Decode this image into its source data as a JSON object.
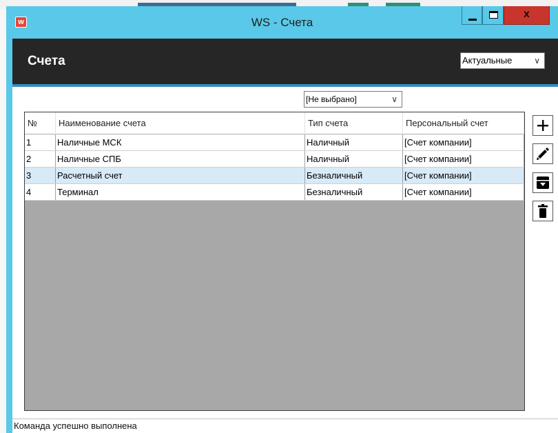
{
  "window": {
    "title": "WS - Счета"
  },
  "header": {
    "title": "Счета"
  },
  "filters": {
    "status_value": "Актуальные",
    "type_value": "[Не выбрано]"
  },
  "table": {
    "columns": [
      "№",
      "Наименование счета",
      "Тип счета",
      "Персональный счет"
    ],
    "rows": [
      [
        "1",
        "Наличные МСК",
        "Наличный",
        "[Счет компании]"
      ],
      [
        "2",
        "Наличные СПБ",
        "Наличный",
        "[Счет компании]"
      ],
      [
        "3",
        "Расчетный счет",
        "Безналичный",
        "[Счет компании]"
      ],
      [
        "4",
        "Терминал",
        "Безналичный",
        "[Счет компании]"
      ]
    ],
    "selected_row": 3
  },
  "toolbar": {
    "icons": [
      "plus-icon",
      "pencil-icon",
      "archive-icon",
      "trash-icon"
    ]
  },
  "status": {
    "message": "Команда успешно выполнена"
  },
  "colors": {
    "titlebar": "#5ac8e8",
    "header": "#262626",
    "accent": "#3a8ac4",
    "close": "#c8352c",
    "grid_empty": "#a8a8a8",
    "row_selected": "#d8eaf7"
  }
}
